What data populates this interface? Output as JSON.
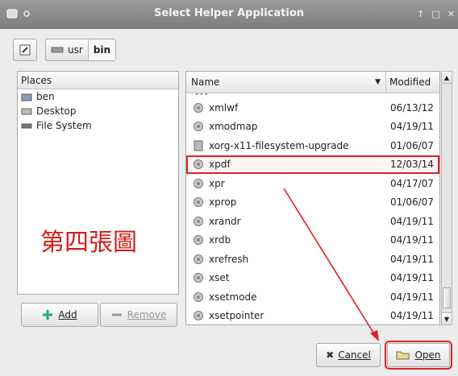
{
  "window": {
    "title": "Select Helper Application",
    "controls": [
      "up-icon",
      "maximize-icon",
      "close-icon"
    ]
  },
  "pathbar": {
    "crumbs": [
      "usr",
      "bin"
    ],
    "active": "bin"
  },
  "places": {
    "header": "Places",
    "items": [
      {
        "label": "ben",
        "icon": "home-folder-icon"
      },
      {
        "label": "Desktop",
        "icon": "desktop-icon"
      },
      {
        "label": "File System",
        "icon": "drive-icon"
      }
    ],
    "add_label": "Add",
    "remove_label": "Remove"
  },
  "annotation": "第四張圖",
  "files": {
    "col_name": "Name",
    "col_modified": "Modified",
    "rows": [
      {
        "name": "xmlwf",
        "date": "06/13/12",
        "icon": "exec-icon"
      },
      {
        "name": "xmodmap",
        "date": "04/19/11",
        "icon": "exec-icon"
      },
      {
        "name": "xorg-x11-filesystem-upgrade",
        "date": "01/06/07",
        "icon": "script-icon"
      },
      {
        "name": "xpdf",
        "date": "12/03/14",
        "icon": "exec-icon",
        "selected": true
      },
      {
        "name": "xpr",
        "date": "04/17/07",
        "icon": "exec-icon"
      },
      {
        "name": "xprop",
        "date": "01/06/07",
        "icon": "exec-icon"
      },
      {
        "name": "xrandr",
        "date": "04/19/11",
        "icon": "exec-icon"
      },
      {
        "name": "xrdb",
        "date": "04/19/11",
        "icon": "exec-icon"
      },
      {
        "name": "xrefresh",
        "date": "04/19/11",
        "icon": "exec-icon"
      },
      {
        "name": "xset",
        "date": "04/19/11",
        "icon": "exec-icon"
      },
      {
        "name": "xsetmode",
        "date": "04/19/11",
        "icon": "exec-icon"
      },
      {
        "name": "xsetpointer",
        "date": "04/19/11",
        "icon": "exec-icon"
      }
    ]
  },
  "buttons": {
    "cancel": "Cancel",
    "open": "Open"
  },
  "colors": {
    "highlight": "#dd2222",
    "titlebar": "#8a8a8a"
  }
}
